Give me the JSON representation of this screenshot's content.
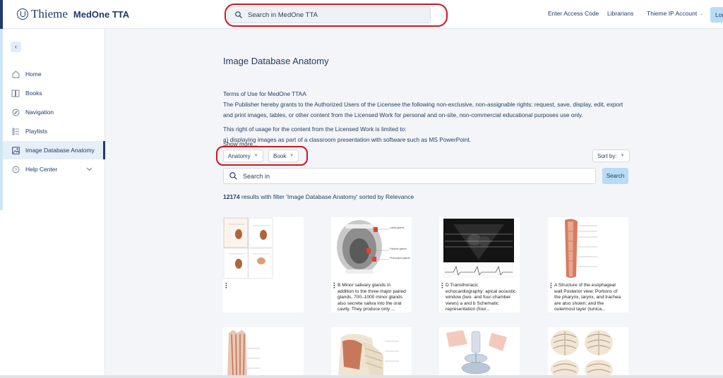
{
  "header": {
    "brand_name": "Thieme",
    "product": "MedOne TTA",
    "search_placeholder": "Search in MedOne TTA",
    "links": [
      "Enter Access Code",
      "Librarians",
      "Thieme IP Account"
    ],
    "login_label": "Log"
  },
  "sidebar": {
    "items": [
      {
        "label": "Home",
        "icon": "home-icon"
      },
      {
        "label": "Books",
        "icon": "book-icon"
      },
      {
        "label": "Navigation",
        "icon": "compass-icon"
      },
      {
        "label": "Playlists",
        "icon": "list-icon"
      },
      {
        "label": "Image Database Anatomy",
        "icon": "image-icon",
        "active": true
      },
      {
        "label": "Help Center",
        "icon": "help-icon"
      }
    ]
  },
  "main": {
    "title": "Image Database Anatomy",
    "terms_heading": "Terms of Use for MedOne TTAA",
    "terms_body": "The Publisher hereby grants to the Authorized Users of the Licensee the following non-exclusive, non-assignable rights: request, save, display, edit, export and print images, tables, or other content from the Licensed Work for personal and on-site, non-commercial educational purposes use only.",
    "terms_right": "This right of usage for the content from the Licensed Work is limited to:",
    "terms_item_a": "a) displaying images as part of a classroom presentation with software such as MS PowerPoint.",
    "show_more": "Show more...",
    "filters": [
      "Anatomy",
      "Book"
    ],
    "sort_label": "Sort by:",
    "search_placeholder": "Search in",
    "search_button": "Search",
    "results_count": "12174",
    "results_text": " results with filter 'Image Database Anatomy' sorted by Relevance"
  },
  "cards": [
    {
      "caption": ""
    },
    {
      "caption": "B Minor salivary glands in addition to the three major paired glands, 700–1000 minor glands also secrete saliva into the oral cavity. They produce only ..."
    },
    {
      "caption": "D Transthoracic echocardiography: apical acoustic window (two- and four-chamber views) a and b Schematic representation (four..."
    },
    {
      "caption": "A Structure of the esophageal wall Posterior view. Portions of the pharynx, larynx, and trachea are also shown; and the outermost layer (tunica..."
    },
    {
      "caption": ""
    },
    {
      "caption": ""
    },
    {
      "caption": ""
    },
    {
      "caption": ""
    }
  ],
  "thumb_labels": {
    "saliva": [
      "Labial glands",
      "Palatine glands",
      "Pharyngeal glands"
    ]
  },
  "colors": {
    "brand": "#1f3a6e",
    "accent_button": "#b9dcf5",
    "annotation": "#d0151f"
  }
}
